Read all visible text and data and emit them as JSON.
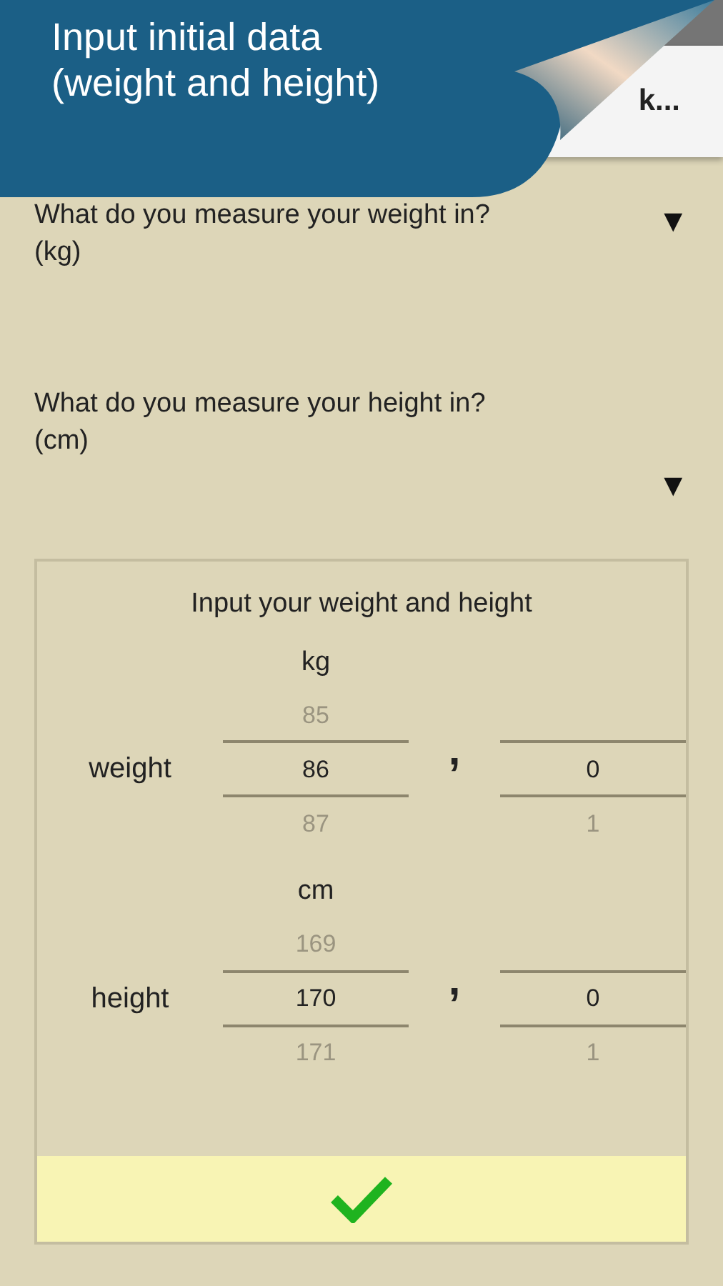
{
  "banner": {
    "lines": [
      "Input initial data",
      "(weight and height)"
    ]
  },
  "app_bar": {
    "title": "k..."
  },
  "questions": [
    {
      "text": "What do you measure your weight in?",
      "value": "(kg)",
      "arrow": "▼"
    },
    {
      "text": "What do you measure your height in?",
      "value": "(cm)",
      "arrow": "▼"
    }
  ],
  "card": {
    "title": "Input your weight and height",
    "rows": [
      {
        "label": "weight",
        "unit": "kg",
        "separator": ",",
        "integer": {
          "prev": "85",
          "current": "86",
          "next": "87"
        },
        "decimal": {
          "current": "0",
          "next": "1"
        }
      },
      {
        "label": "height",
        "unit": "cm",
        "separator": ",",
        "integer": {
          "prev": "169",
          "current": "170",
          "next": "171"
        },
        "decimal": {
          "current": "0",
          "next": "1"
        }
      }
    ]
  }
}
